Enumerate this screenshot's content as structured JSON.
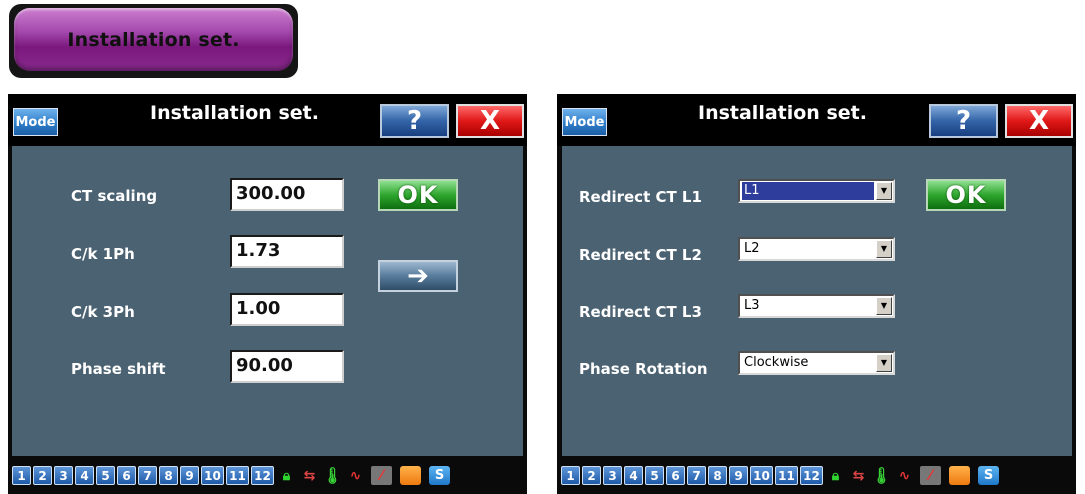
{
  "header_button": {
    "label": "Installation set."
  },
  "left_panel": {
    "mode_label": "Mode",
    "title": "Installation set.",
    "help_label": "?",
    "close_label": "X",
    "fields": [
      {
        "label": "CT scaling",
        "value": "300.00"
      },
      {
        "label": "C/k 1Ph",
        "value": "1.73"
      },
      {
        "label": "C/k 3Ph",
        "value": "1.00"
      },
      {
        "label": "Phase shift",
        "value": "90.00"
      }
    ],
    "ok_label": "OK",
    "next_label": "➔"
  },
  "right_panel": {
    "mode_label": "Mode",
    "title": "Installation set.",
    "help_label": "?",
    "close_label": "X",
    "selects": [
      {
        "label": "Redirect CT L1",
        "value": "L1"
      },
      {
        "label": "Redirect CT L2",
        "value": "L2"
      },
      {
        "label": "Redirect CT L3",
        "value": "L3"
      },
      {
        "label": "Phase Rotation",
        "value": "Clockwise"
      }
    ],
    "ok_label": "OK"
  },
  "bottom_bar": {
    "pages": [
      "1",
      "2",
      "3",
      "4",
      "5",
      "6",
      "7",
      "8",
      "9",
      "10",
      "11",
      "12"
    ],
    "icons": [
      "lock-icon",
      "swap-icon",
      "thermometer-icon",
      "graph-icon",
      "graph-disabled-icon",
      "orange-square-icon",
      "s-icon"
    ],
    "s_label": "S"
  }
}
